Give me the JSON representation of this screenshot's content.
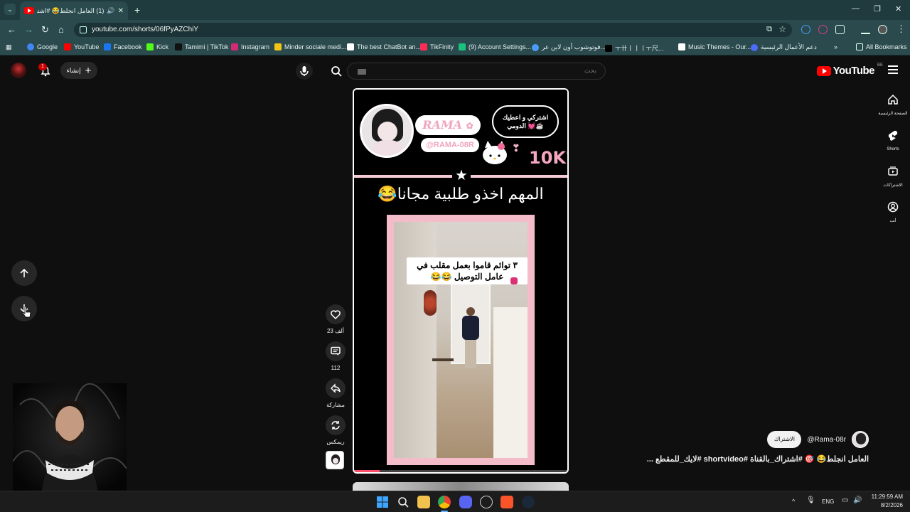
{
  "browser": {
    "tab": {
      "title": "(1) العامل انجلط😂 #اشتر",
      "favicon": "youtube-favicon",
      "audio_icon": "🔊",
      "close_icon": "✕"
    },
    "new_tab_icon": "+",
    "window_controls": {
      "minimize": "—",
      "restore": "❐",
      "close": "✕"
    },
    "nav": {
      "back": "←",
      "forward": "→",
      "reload": "↻",
      "home": "⌂"
    },
    "url": "youtube.com/shorts/06fPyAZChiY",
    "bookmarks": [
      {
        "label": "Google",
        "color": "#4285f4"
      },
      {
        "label": "YouTube",
        "color": "#ff0000"
      },
      {
        "label": "Facebook",
        "color": "#1877f2"
      },
      {
        "label": "Kick",
        "color": "#53fc18"
      },
      {
        "label": "Tamimi | TikTok",
        "color": "#111111"
      },
      {
        "label": "Instagram",
        "color": "#d62976"
      },
      {
        "label": "Minder sociale medi...",
        "color": "#f5c518"
      },
      {
        "label": "The best ChatBot an...",
        "color": "#ffffff"
      },
      {
        "label": "TikFinity",
        "color": "#fe2c55"
      },
      {
        "label": "(9) Account Settings...",
        "color": "#19c37d"
      },
      {
        "label": "فوتوشوب أون لاين عر...",
        "color": "#4b9bff"
      },
      {
        "label": "ㅜ卄丨丨ㅣㅜ尺...",
        "color": "#000000"
      },
      {
        "label": "Music Themes - Our...",
        "color": "#ffffff"
      },
      {
        "label": "دعم الأعمال الرئيسية",
        "color": "#4b6bfb"
      }
    ],
    "all_bookmarks": "All Bookmarks"
  },
  "youtube": {
    "logo_text": "YouTube",
    "region": "BE",
    "search_placeholder": "بحث",
    "create_label": "إنشاء",
    "notification_count": "1",
    "right_nav": [
      {
        "label": "الصفحة الرئيسية",
        "icon": "home-icon"
      },
      {
        "label": "Shorts",
        "icon": "shorts-icon"
      },
      {
        "label": "الاشتراكات",
        "icon": "subscriptions-icon"
      },
      {
        "label": "أنت",
        "icon": "you-icon"
      }
    ]
  },
  "short": {
    "overlay": {
      "name": "RAMA",
      "flower": "✿",
      "handle": "@RAMA-08R",
      "sub_bubble": "اشتركي و اعطيك الدومي 💓☕",
      "hearts": "❣",
      "goal": "10K?",
      "star": "★",
      "caption": "المهم اخذو طلبية مجانا😂"
    },
    "clip_caption": "٣ توائم قاموا بعمل مقلب في عامل التوصيل 😂😂",
    "progress": 0.12
  },
  "actions": {
    "like_count": "23 ألف",
    "comment_count": "112",
    "share_label": "مشاركة",
    "remix_label": "ريمكس"
  },
  "channel": {
    "name": "@Rama-08r",
    "subscribe_label": "الاشتراك"
  },
  "video_title": "العامل انجلط😂 🎯 #اشتراك_بالقناة #shortvideo #لايك_للمقطع ...",
  "taskbar": {
    "language": "ENG",
    "time": "11:29:59 AM",
    "date": "8/2/2026"
  },
  "colors": {
    "accent_pink": "#f4a6bf",
    "youtube_red": "#ff0000",
    "chrome_teal": "#2a4a4d"
  }
}
